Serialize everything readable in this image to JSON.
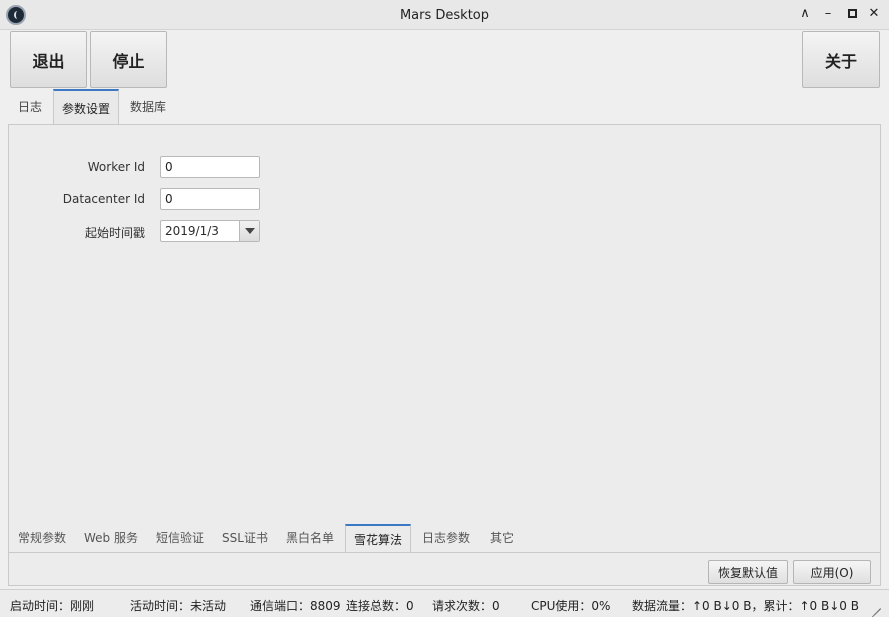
{
  "window": {
    "title": "Mars Desktop"
  },
  "toolbar": {
    "exit_label": "退出",
    "stop_label": "停止",
    "about_label": "关于"
  },
  "tabs_top": [
    {
      "label": "日志"
    },
    {
      "label": "参数设置"
    },
    {
      "label": "数据库"
    }
  ],
  "form": {
    "worker_id_label": "Worker Id",
    "worker_id_value": "0",
    "datacenter_id_label": "Datacenter Id",
    "datacenter_id_value": "0",
    "start_time_label": "起始时间戳",
    "start_time_value": "2019/1/3"
  },
  "tabs_bottom": [
    {
      "label": "常规参数"
    },
    {
      "label": "Web 服务"
    },
    {
      "label": "短信验证"
    },
    {
      "label": "SSL证书"
    },
    {
      "label": "黑白名单"
    },
    {
      "label": "雪花算法"
    },
    {
      "label": "日志参数"
    },
    {
      "label": "其它"
    }
  ],
  "actions": {
    "restore_label": "恢复默认值",
    "apply_label": "应用(O)"
  },
  "status": {
    "start_time": "启动时间：刚刚",
    "active_time": "活动时间：未活动",
    "port": "通信端口：8809",
    "connections": "连接总数：0",
    "requests": "请求次数：0",
    "cpu": "CPU使用：0%",
    "traffic": "数据流量：↑0 B↓0 B，累计：↑0 B↓0 B"
  },
  "colors": {
    "accent": "#3c78c3"
  }
}
